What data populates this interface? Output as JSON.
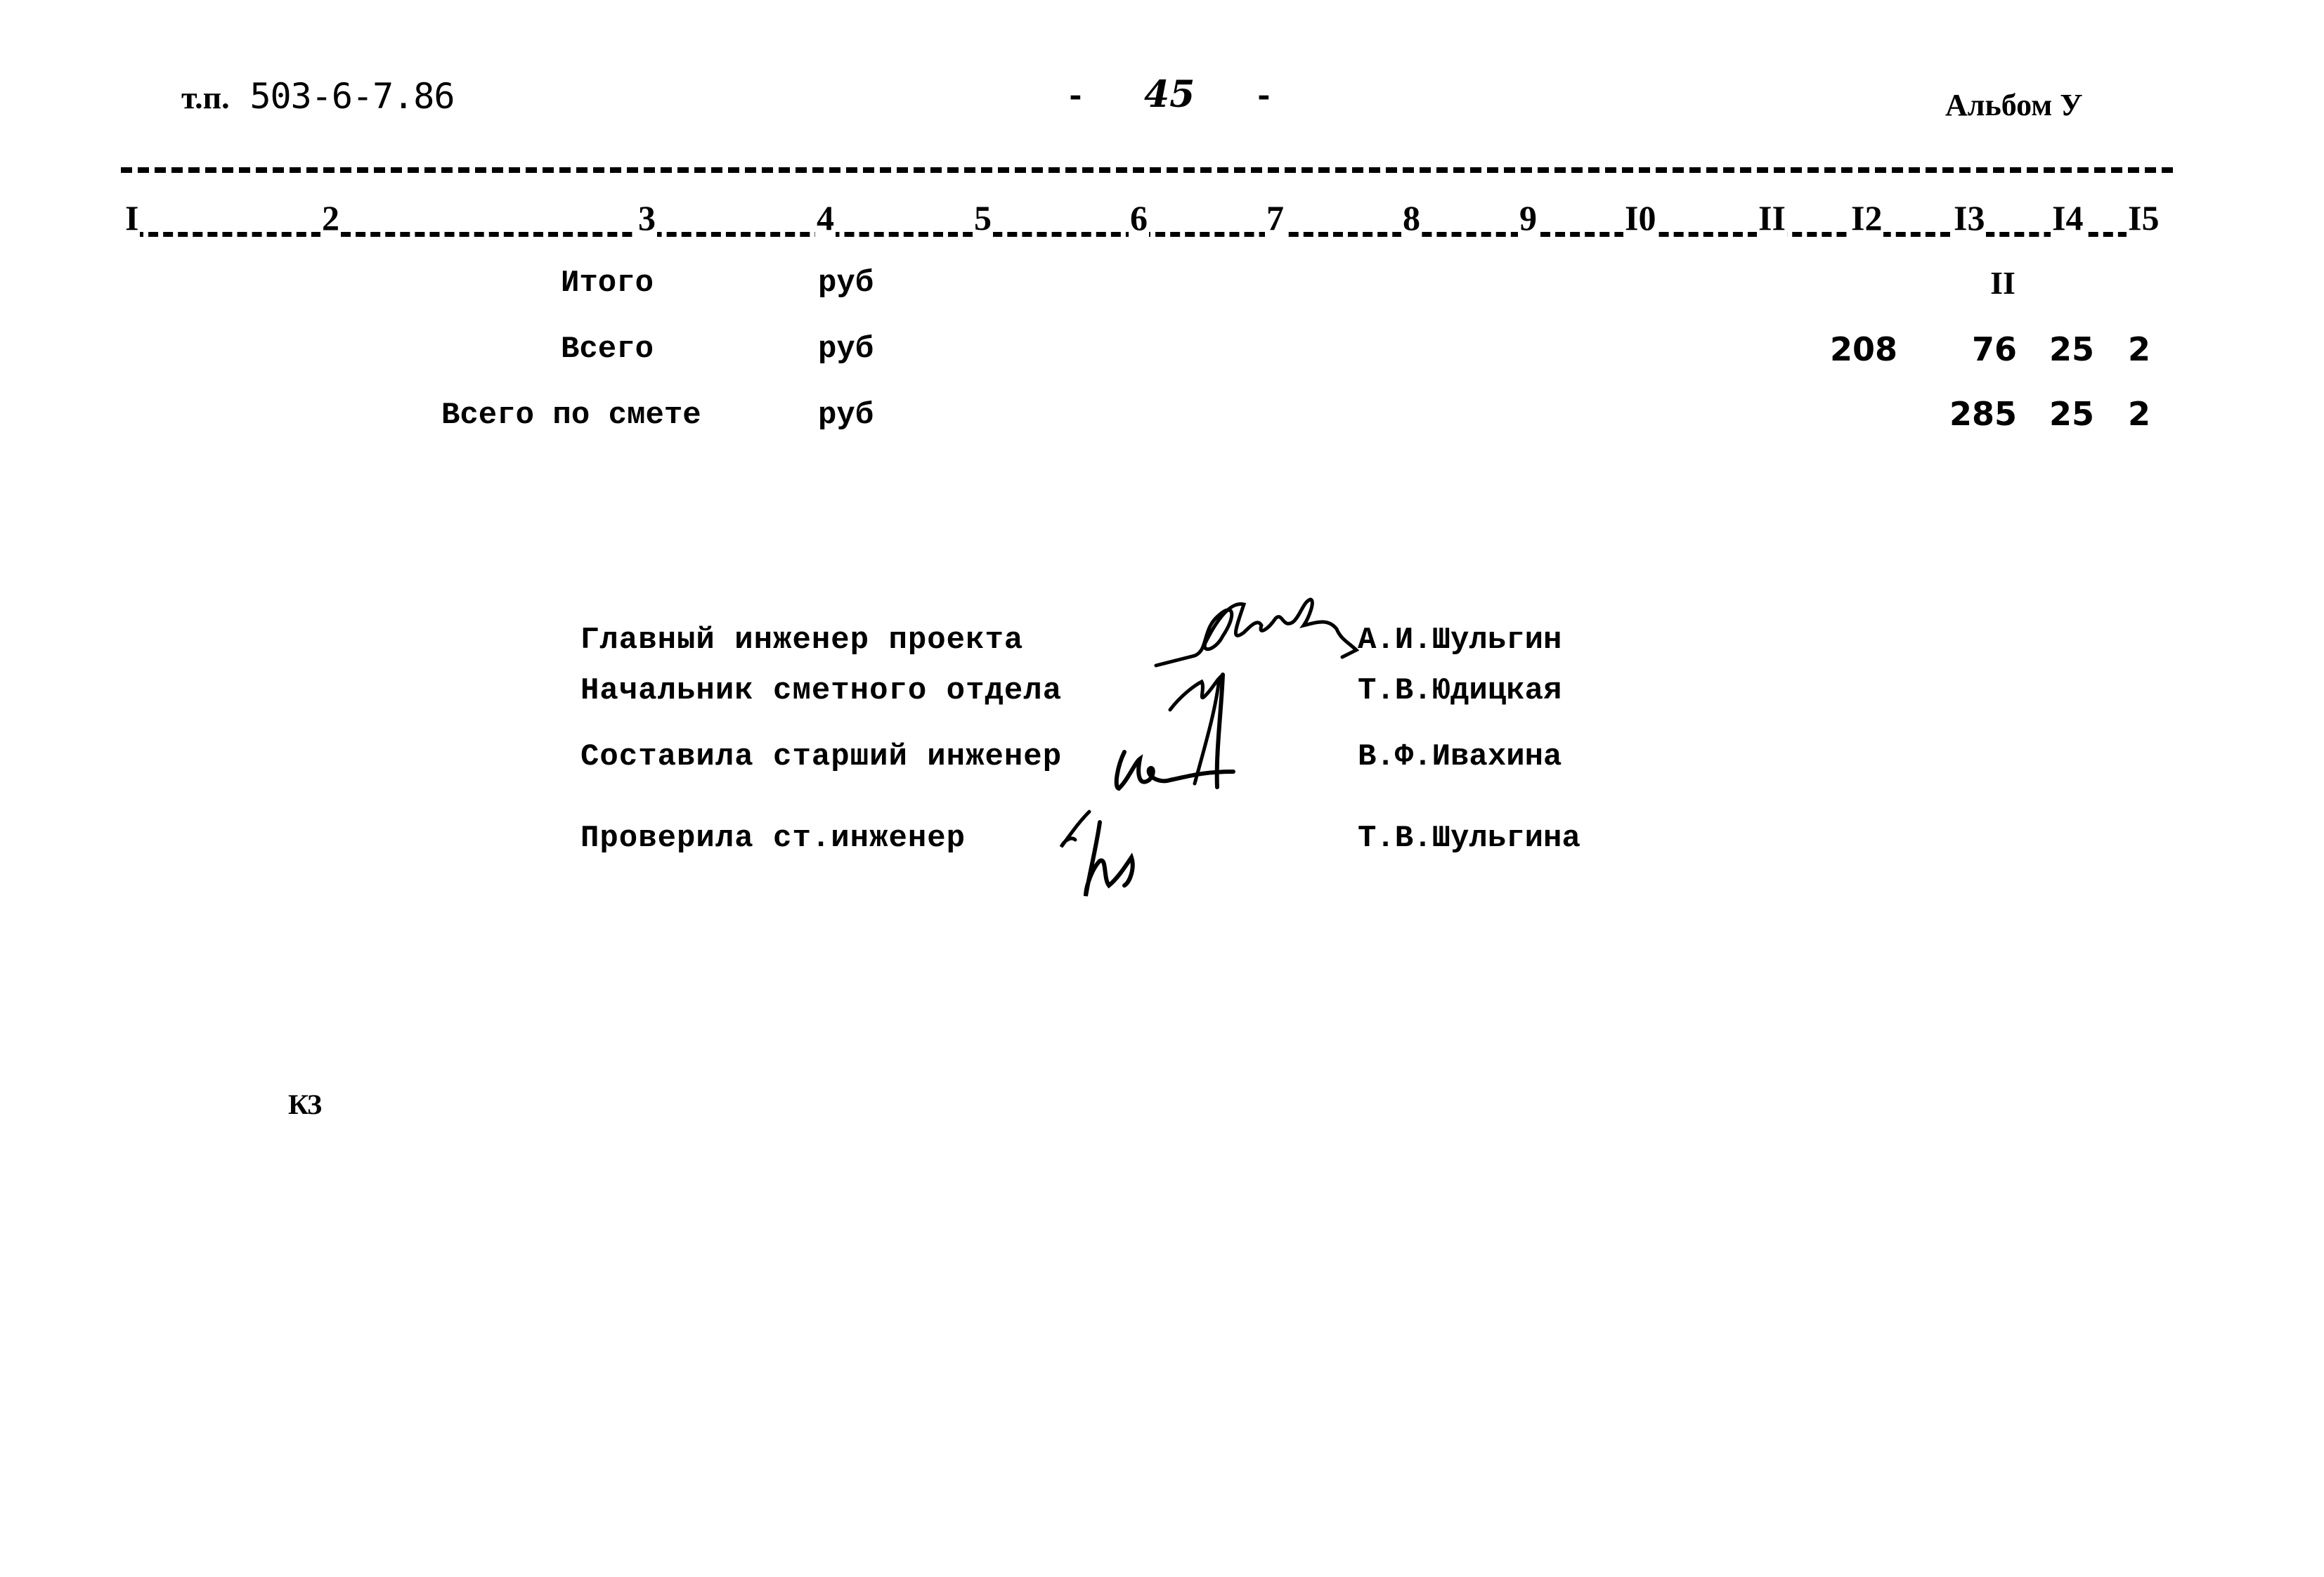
{
  "header": {
    "doc_prefix": "т.п.",
    "doc_number": "503-6-7.86",
    "page_number": "45",
    "page_dash_left": "-",
    "page_dash_right": "-",
    "album": "Альбом У"
  },
  "columns": [
    "I",
    "2",
    "3",
    "4",
    "5",
    "6",
    "7",
    "8",
    "9",
    "I0",
    "II",
    "I2",
    "I3",
    "I4",
    "I5"
  ],
  "rows": [
    {
      "label": "Итого",
      "unit": "руб",
      "col12": "",
      "col13": "II",
      "col14": "",
      "col15": ""
    },
    {
      "label": "Всего",
      "unit": "руб",
      "col12": "208",
      "col13": "76",
      "col14": "25",
      "col15": "2"
    },
    {
      "label": "Всего по смете",
      "unit": "руб",
      "col12": "",
      "col13": "285",
      "col14": "25",
      "col15": "2"
    }
  ],
  "signatures": [
    {
      "title": "Главный инженер проекта",
      "name": "А.И.Шульгин",
      "signature_icon": "handwritten-signature"
    },
    {
      "title": "Начальник сметного отдела",
      "name": "Т.В.Юдицкая",
      "signature_icon": "handwritten-signature"
    },
    {
      "title": "Составила старший инженер",
      "name": "В.Ф.Ивахина",
      "signature_icon": "handwritten-signature"
    },
    {
      "title": "Проверила ст.инженер",
      "name": "Т.В.Шульгина",
      "signature_icon": "handwritten-signature"
    }
  ],
  "footer": {
    "mark": "КЗ"
  }
}
